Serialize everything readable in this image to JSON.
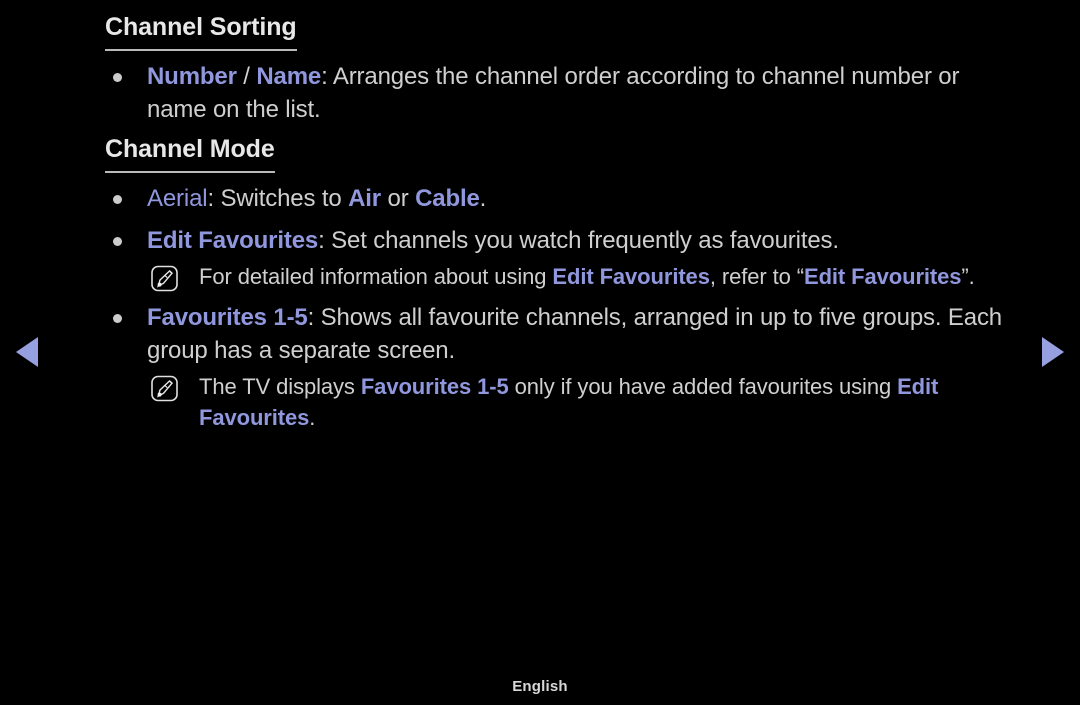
{
  "page": {
    "background_color": "#000000",
    "text_color": "#cfcfcf",
    "accent_color": "#9097dd",
    "heading_color": "#e8e8e8"
  },
  "sections": [
    {
      "heading": "Channel Sorting",
      "items": [
        {
          "type": "bullet",
          "parts": [
            {
              "text": "Number",
              "style": "keyword"
            },
            {
              "text": " / ",
              "style": "plain"
            },
            {
              "text": "Name",
              "style": "keyword"
            },
            {
              "text": ": Arranges the channel order according to channel number or name on the list.",
              "style": "plain"
            }
          ]
        }
      ]
    },
    {
      "heading": "Channel Mode",
      "items": [
        {
          "type": "bullet",
          "parts": [
            {
              "text": "Aerial",
              "style": "keyword-regular"
            },
            {
              "text": ": Switches to ",
              "style": "plain"
            },
            {
              "text": "Air",
              "style": "keyword"
            },
            {
              "text": " or ",
              "style": "plain"
            },
            {
              "text": "Cable",
              "style": "keyword"
            },
            {
              "text": ".",
              "style": "plain"
            }
          ]
        },
        {
          "type": "bullet",
          "parts": [
            {
              "text": "Edit Favourites",
              "style": "keyword"
            },
            {
              "text": ": Set channels you watch frequently as favourites.",
              "style": "plain"
            }
          ]
        },
        {
          "type": "note",
          "icon": "note-icon",
          "parts": [
            {
              "text": "For detailed information about using ",
              "style": "plain"
            },
            {
              "text": "Edit Favourites",
              "style": "keyword"
            },
            {
              "text": ", refer to “",
              "style": "plain"
            },
            {
              "text": "Edit Favourites",
              "style": "keyword"
            },
            {
              "text": "”.",
              "style": "plain"
            }
          ]
        },
        {
          "type": "bullet",
          "parts": [
            {
              "text": "Favourites 1-5",
              "style": "keyword"
            },
            {
              "text": ": Shows all favourite channels, arranged in up to five groups. Each group has a separate screen.",
              "style": "plain"
            }
          ]
        },
        {
          "type": "note",
          "icon": "note-icon",
          "parts": [
            {
              "text": "The TV displays ",
              "style": "plain"
            },
            {
              "text": "Favourites 1-5",
              "style": "keyword"
            },
            {
              "text": " only if you have added favourites using ",
              "style": "plain"
            },
            {
              "text": "Edit Favourites",
              "style": "keyword"
            },
            {
              "text": ".",
              "style": "plain"
            }
          ]
        }
      ]
    }
  ],
  "navigation": {
    "previous_label": "◀",
    "previous_name": "previous-page-arrow",
    "next_label": "▶",
    "next_name": "next-page-arrow"
  },
  "footer": {
    "language": "English"
  }
}
